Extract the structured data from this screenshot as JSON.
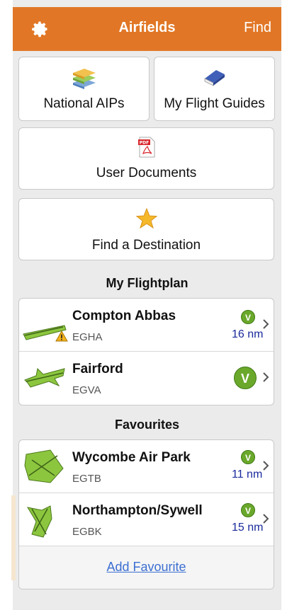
{
  "header": {
    "title": "Airfields",
    "find_label": "Find",
    "settings_icon": "gear-icon"
  },
  "tiles": {
    "national_aips": {
      "label": "National AIPs",
      "icon": "stacked-books-icon"
    },
    "my_flight_guides": {
      "label": "My Flight Guides",
      "icon": "book-icon"
    },
    "user_documents": {
      "label": "User Documents",
      "icon": "pdf-document-icon"
    },
    "find_destination": {
      "label": "Find a Destination",
      "icon": "star-icon"
    }
  },
  "flightplan": {
    "title": "My Flightplan",
    "items": [
      {
        "name": "Compton Abbas",
        "code": "EGHA",
        "vfr": "V",
        "distance": "16 nm",
        "warning": true
      },
      {
        "name": "Fairford",
        "code": "EGVA",
        "vfr": "V",
        "distance": "",
        "warning": false
      }
    ]
  },
  "favourites": {
    "title": "Favourites",
    "items": [
      {
        "name": "Wycombe Air Park",
        "code": "EGTB",
        "vfr": "V",
        "distance": "11 nm"
      },
      {
        "name": "Northampton/Sywell",
        "code": "EGBK",
        "vfr": "V",
        "distance": "15 nm"
      }
    ],
    "add_label": "Add Favourite"
  },
  "colors": {
    "header": "#e17726",
    "vfr_green": "#6aa82b",
    "distance_blue": "#1a2a9c",
    "link_blue": "#3b6fd1",
    "airfield_green": "#8cc63f"
  }
}
